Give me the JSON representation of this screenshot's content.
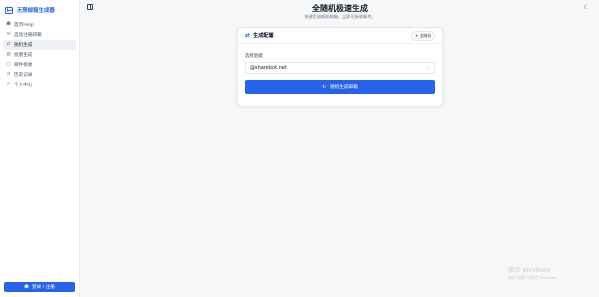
{
  "brand": {
    "name": "无限邮箱生成器",
    "icon": "mail-icon"
  },
  "sidebar": {
    "items": [
      {
        "label": "首页Help",
        "icon": "person-icon",
        "active": false
      },
      {
        "label": "自动注册邮箱",
        "icon": "inbox-icon",
        "active": false
      },
      {
        "label": "随机生成",
        "icon": "shuffle-icon",
        "active": true
      },
      {
        "label": "批量生成",
        "icon": "layers-icon",
        "active": false
      },
      {
        "label": "邮件接收",
        "icon": "mailbox-icon",
        "active": false
      },
      {
        "label": "历史记录",
        "icon": "history-icon",
        "active": false
      },
      {
        "label": "个人中心",
        "icon": "user-icon",
        "active": false
      }
    ],
    "login_label": "登录 / 注册"
  },
  "header": {
    "title": "全随机极速生成",
    "subtitle": "快速生成随机邮箱，立即可接收邮件。"
  },
  "card": {
    "title": "生成配置",
    "badge": "全随机",
    "field_label": "选择后缀",
    "selected_domain": "@sharebot.net",
    "generate_label": "随机生成邮箱"
  },
  "watermark": {
    "title": "激活 Windows",
    "subtitle": "转到\"设置\"以激活 Windows。"
  },
  "colors": {
    "accent": "#2563eb",
    "background": "#f6f7f9"
  }
}
